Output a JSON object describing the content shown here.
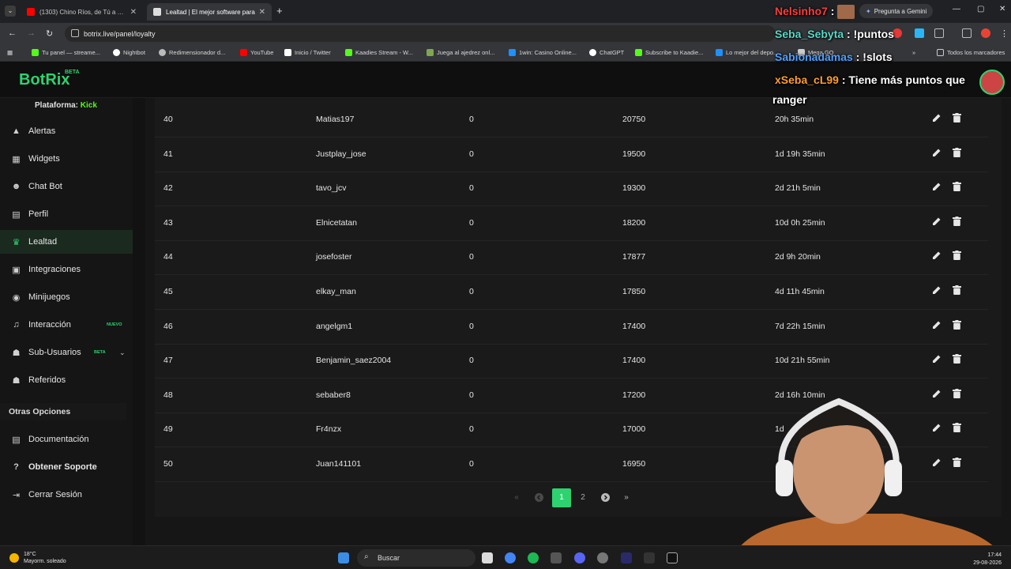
{
  "browser": {
    "tabs": [
      {
        "title": "(1303) Chino Ríos, de Tú a Tú, C",
        "active": false
      },
      {
        "title": "Lealtad | El mejor software para",
        "active": true
      }
    ],
    "url": "botrix.live/panel/loyalty",
    "gemini_label": "Pregunta a Gemini",
    "bookmarks": [
      {
        "label": "Tu panel — streame...",
        "color": "#53fc18"
      },
      {
        "label": "Nightbot",
        "color": "#ffffff"
      },
      {
        "label": "Redimensionador d...",
        "color": "#bbbbbb"
      },
      {
        "label": "YouTube",
        "color": "#ff0000"
      },
      {
        "label": "Inicio / Twitter",
        "color": "#ffffff"
      },
      {
        "label": "Kaadies Stream - W...",
        "color": "#53fc18"
      },
      {
        "label": "Juega al ajedrez onl...",
        "color": "#7fa650"
      },
      {
        "label": "1win: Casino Online...",
        "color": "#1e90ff"
      },
      {
        "label": "ChatGPT",
        "color": "#ffffff"
      },
      {
        "label": "Subscribe to Kaadie...",
        "color": "#53fc18"
      },
      {
        "label": "Lo mejor del depo...",
        "color": "#1e90ff"
      },
      {
        "label": "Mega GO",
        "color": "#cccccc"
      }
    ],
    "bookmarks_folder": "Todos los marcadores"
  },
  "app": {
    "logo": "BotRix",
    "logo_beta": "BETA",
    "platform_label": "Plataforma:",
    "platform_value": "Kick",
    "brand_color": "#2dd36f"
  },
  "sidebar": {
    "items": [
      {
        "label": "Alertas",
        "icon": "warning-icon",
        "glyph": "▲"
      },
      {
        "label": "Widgets",
        "icon": "grid-icon",
        "glyph": "▦"
      },
      {
        "label": "Chat Bot",
        "icon": "robot-icon",
        "glyph": "☻"
      },
      {
        "label": "Perfil",
        "icon": "id-card-icon",
        "glyph": "▤"
      },
      {
        "label": "Lealtad",
        "icon": "trophy-icon",
        "glyph": "♛"
      },
      {
        "label": "Integraciones",
        "icon": "integrations-icon",
        "glyph": "▣"
      },
      {
        "label": "Minijuegos",
        "icon": "gamepad-icon",
        "glyph": "◉"
      },
      {
        "label": "Interacción",
        "icon": "music-icon",
        "glyph": "♫"
      },
      {
        "label": "Sub-Usuarios",
        "icon": "users-icon",
        "glyph": "☗"
      },
      {
        "label": "Referidos",
        "icon": "referrals-icon",
        "glyph": "☗"
      }
    ],
    "interaccion_badge": "NUEVO",
    "subusers_badge": "BETA",
    "other_title": "Otras Opciones",
    "other_items": [
      {
        "label": "Documentación",
        "icon": "document-icon",
        "glyph": "▤"
      },
      {
        "label": "Obtener Soporte",
        "icon": "help-icon",
        "glyph": "?"
      },
      {
        "label": "Cerrar Sesión",
        "icon": "logout-icon",
        "glyph": "⇥"
      }
    ]
  },
  "table": {
    "rows": [
      {
        "rank": "40",
        "user": "Matias197",
        "zero": "0",
        "points": "20750",
        "time": "20h 35min"
      },
      {
        "rank": "41",
        "user": "Justplay_jose",
        "zero": "0",
        "points": "19500",
        "time": "1d 19h 35min"
      },
      {
        "rank": "42",
        "user": "tavo_jcv",
        "zero": "0",
        "points": "19300",
        "time": "2d 21h 5min"
      },
      {
        "rank": "43",
        "user": "Elnicetatan",
        "zero": "0",
        "points": "18200",
        "time": "10d 0h 25min"
      },
      {
        "rank": "44",
        "user": "josefoster",
        "zero": "0",
        "points": "17877",
        "time": "2d 9h 20min"
      },
      {
        "rank": "45",
        "user": "elkay_man",
        "zero": "0",
        "points": "17850",
        "time": "4d 11h 45min"
      },
      {
        "rank": "46",
        "user": "angelgm1",
        "zero": "0",
        "points": "17400",
        "time": "7d 22h 15min"
      },
      {
        "rank": "47",
        "user": "Benjamin_saez2004",
        "zero": "0",
        "points": "17400",
        "time": "10d 21h 55min"
      },
      {
        "rank": "48",
        "user": "sebaber8",
        "zero": "0",
        "points": "17200",
        "time": "2d 16h 10min"
      },
      {
        "rank": "49",
        "user": "Fr4nzx",
        "zero": "0",
        "points": "17000",
        "time": "1d"
      },
      {
        "rank": "50",
        "user": "Juan141101",
        "zero": "0",
        "points": "16950",
        "time": ""
      }
    ]
  },
  "pagination": {
    "first": "«",
    "prev": "‹",
    "pages": [
      "1",
      "2"
    ],
    "current": "1",
    "next": "›",
    "last": "»"
  },
  "chat_overlay": [
    {
      "user": "Nelsinho7",
      "message": "",
      "color": "#ff3c3c"
    },
    {
      "user": "Seba_Sebyta",
      "message": "!puntos",
      "color": "#56d9c8"
    },
    {
      "user": "Sabionadamas",
      "message": "!slots",
      "color": "#4fa0ff"
    },
    {
      "user": "xSeba_cL99",
      "message": "Tiene más puntos que",
      "color": "#ff9d2c"
    }
  ],
  "chat_overlay_wrap": "ranger",
  "taskbar": {
    "temperature": "18°C",
    "weather": "Mayorm. soleado",
    "search": "Buscar",
    "time": "17:44",
    "date": "29-08-2026"
  }
}
